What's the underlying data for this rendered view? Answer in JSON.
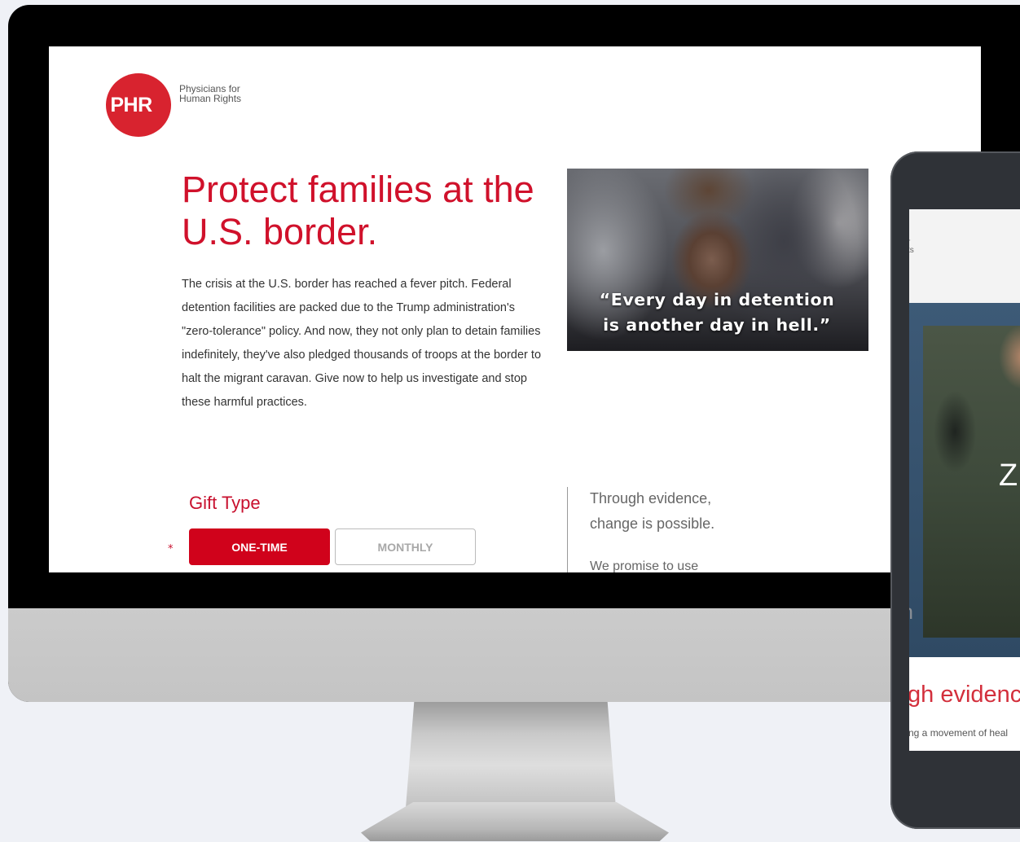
{
  "logo": {
    "mark": "PHR",
    "org_line1": "Physicians for",
    "org_line2": "Human Rights"
  },
  "headline": "Protect families at the U.S. border.",
  "body_copy": "The crisis at the U.S. border has reached a fever pitch. Federal detention facilities are packed due to the Trump administration's \"zero-tolerance\" policy. And now, they not only plan to detain families indefinitely, they've also pledged thousands of troops at the border to halt the migrant caravan. Give now to help us investigate and stop these harmful practices.",
  "hero": {
    "quote_line1": "“Every day in detention",
    "quote_line2": "is another day in hell.”"
  },
  "gift": {
    "label": "Gift Type",
    "required_mark": "*",
    "options": [
      "ONE-TIME",
      "MONTHLY"
    ],
    "selected": "ONE-TIME",
    "accent_color": "#d0021b"
  },
  "side_message": {
    "line1": "Through evidence,",
    "line2": "change is possible.",
    "promise": "We promise to use"
  },
  "tablet": {
    "logo_crop_line1": "r",
    "logo_crop_line2": "ts",
    "hero_letter": "Z",
    "side_text_line1": "c",
    "side_text_line2": "th",
    "evidence_crop": "gh evidenc",
    "movement_crop": "ng a movement of heal"
  },
  "colors": {
    "brand_red": "#d8232f",
    "headline_red": "#d0112b",
    "page_bg": "#eff1f6"
  }
}
